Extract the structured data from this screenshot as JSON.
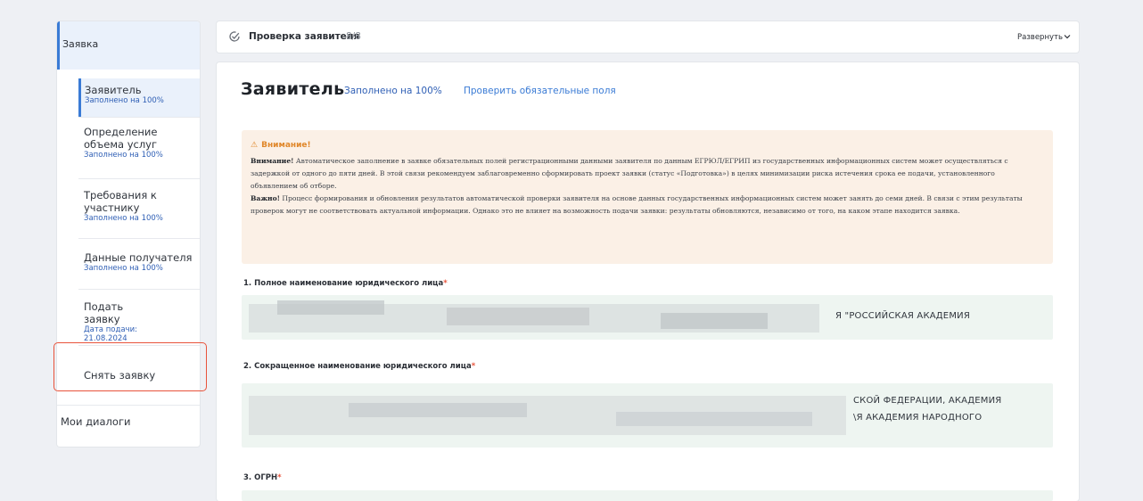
{
  "sidebar": {
    "section": "Заявка",
    "items": [
      {
        "title": "Заявитель",
        "sub": "Заполнено на 100%"
      },
      {
        "title": "Определение объема услуг",
        "sub": "Заполнено на 100%"
      },
      {
        "title": "Требования к участнику",
        "sub": "Заполнено на 100%"
      },
      {
        "title": "Данные получателя",
        "sub": "Заполнено на 100%"
      },
      {
        "title": "Подать заявку",
        "sub": "Дата подачи: 21.08.2024"
      },
      {
        "title": "Снять заявку"
      }
    ],
    "dialogs": "Мои диалоги"
  },
  "topbar": {
    "title": "Проверка заявителя",
    "count": "8/8",
    "expand": "Развернуть",
    "icons": [
      "check-circle-icon",
      "chevron-down-icon"
    ]
  },
  "main": {
    "title": "Заявитель",
    "filled": "Заполнено на 100%",
    "check_link": "Проверить обязательные поля",
    "warning": {
      "heading": "Внимание!",
      "p1_bold": "Внимание!",
      "p1": " Автоматическое заполнение в заявке обязательных полей регистрационными данными заявителя по данным ЕГРЮЛ/ЕГРИП из государственных информационных систем может осуществляться с задержкой от одного до пяти дней. В этой связи рекомендуем заблаговременно сформировать проект заявки (статус «Подготовка») в целях минимизации риска истечения срока ее подачи, установленного объявлением об отборе.",
      "p2_bold": "Важно!",
      "p2": " Процесс формирования и обновления результатов автоматической проверки заявителя на основе данных государственных информационных систем может занять до семи дней. В связи с этим результаты проверок могут не соответствовать актуальной информации. Однако это не влияет на возможность подачи заявки: результаты обновляются, независимо от того, на каком этапе находится заявка."
    },
    "fields": [
      {
        "label": "1. Полное наименование юридического лица",
        "value": "Я \"РОССИЙСКАЯ АКАДЕМИЯ"
      },
      {
        "label": "2. Сокращенное наименование юридического лица",
        "value_line1": "СКОЙ ФЕДЕРАЦИИ, АКАДЕМИЯ",
        "value_line2": "\\Я АКАДЕМИЯ НАРОДНОГО"
      },
      {
        "label": "3. ОГРН"
      }
    ]
  },
  "colors": {
    "accent": "#3a7bd5",
    "warning_bg": "#fbf0e6",
    "field_bg": "#eef5f1",
    "highlight": "#e8533b"
  }
}
